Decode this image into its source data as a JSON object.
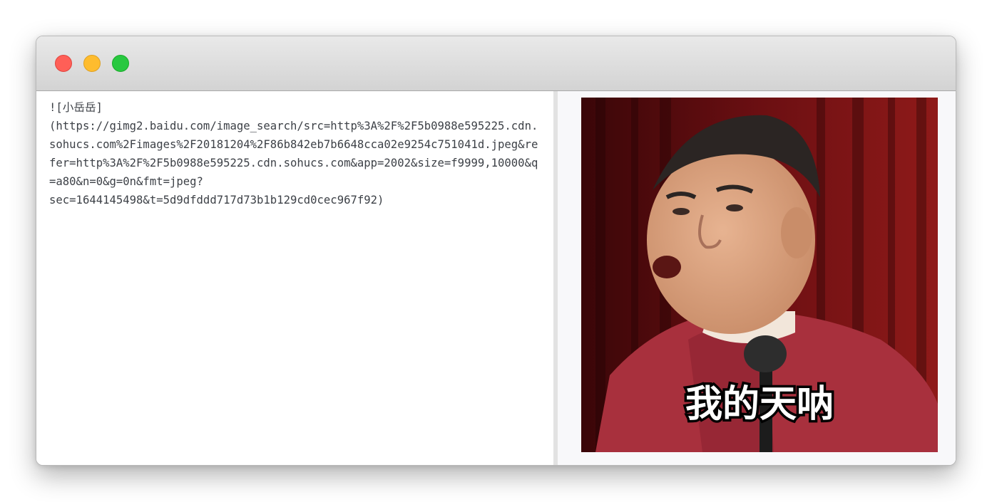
{
  "window": {
    "controls": [
      {
        "name": "close",
        "color": "#ff5f57"
      },
      {
        "name": "minimize",
        "color": "#febc2e"
      },
      {
        "name": "zoom",
        "color": "#28c840"
      }
    ]
  },
  "editor": {
    "lines": [
      "![小岳岳]",
      "(https://gimg2.baidu.com/image_search/src=http%3A%2F%2F5b0988e595225.cdn.sohucs.com%2Fimages%2F20181204%2F86b842eb7b6648cca02e9254c751041d.jpeg&refer=http%3A%2F%2F5b0988e595225.cdn.sohucs.com&app=2002&size=f9999,10000&q=a80&n=0&g=0n&fmt=jpeg?",
      "sec=1644145498&t=5d9dfddd717d73b1b129cd0cec967f92)"
    ]
  },
  "preview": {
    "image": {
      "caption": "我的天呐",
      "background_color": "#6b0f12",
      "jacket_color": "#a8303d",
      "skin_color": "#d9a27f"
    }
  }
}
